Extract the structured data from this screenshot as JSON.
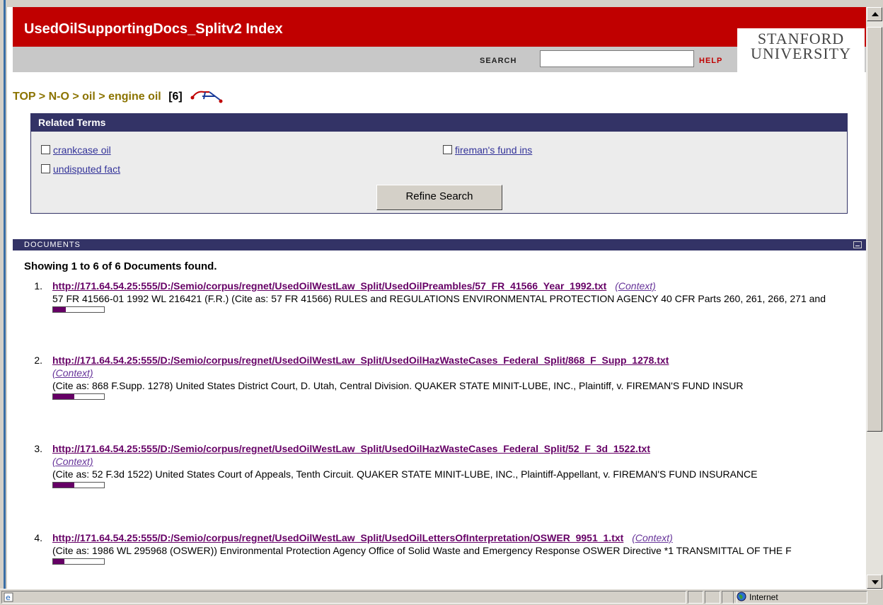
{
  "header": {
    "title": "UsedOilSupportingDocs_Splitv2 Index",
    "search_label": "SEARCH",
    "search_value": "",
    "help_label": "HELP",
    "logo_line1": "STANFORD",
    "logo_line2": "UNIVERSITY"
  },
  "breadcrumb": {
    "top": "TOP",
    "level1": "N-O",
    "level2": "oil",
    "current": "engine oil",
    "count": "[6]",
    "separator": ">"
  },
  "related": {
    "heading": "Related Terms",
    "terms": [
      "crankcase oil",
      "undisputed fact",
      "fireman's fund ins"
    ],
    "refine_label": "Refine Search"
  },
  "documents": {
    "section_label": "DOCUMENTS",
    "showing": "Showing 1 to 6 of 6 Documents found.",
    "context_label": "(Context)",
    "items": [
      {
        "num": "1.",
        "url": "http://171.64.54.25:555/D:/Semio/corpus/regnet/UsedOilWestLaw_Split/UsedOilPreambles/57_FR_41566_Year_1992.txt",
        "snippet": "57 FR 41566-01 1992 WL 216421 (F.R.) (Cite as: 57 FR 41566) RULES and REGULATIONS ENVIRONMENTAL PROTECTION AGENCY 40 CFR Parts 260, 261, 266, 271 and",
        "score": 0.25
      },
      {
        "num": "2.",
        "url": "http://171.64.54.25:555/D:/Semio/corpus/regnet/UsedOilWestLaw_Split/UsedOilHazWasteCases_Federal_Split/868_F_Supp_1278.txt",
        "snippet": "(Cite as: 868 F.Supp. 1278) United States District Court, D. Utah, Central Division. QUAKER STATE MINIT-LUBE, INC., Plaintiff, v. FIREMAN'S FUND INSUR",
        "score": 0.42
      },
      {
        "num": "3.",
        "url": "http://171.64.54.25:555/D:/Semio/corpus/regnet/UsedOilWestLaw_Split/UsedOilHazWasteCases_Federal_Split/52_F_3d_1522.txt",
        "snippet": "(Cite as: 52 F.3d 1522) United States Court of Appeals, Tenth Circuit. QUAKER STATE MINIT-LUBE, INC., Plaintiff-Appellant, v. FIREMAN'S FUND INSURANCE",
        "score": 0.42
      },
      {
        "num": "4.",
        "url": "http://171.64.54.25:555/D:/Semio/corpus/regnet/UsedOilWestLaw_Split/UsedOilLettersOfInterpretation/OSWER_9951_1.txt",
        "snippet": "(Cite as: 1986 WL 295968 (OSWER)) Environmental Protection Agency Office of Solid Waste and Emergency Response OSWER Directive *1 TRANSMITTAL OF THE F",
        "score": 0.22
      }
    ]
  },
  "statusbar": {
    "zone": "Internet",
    "icon": "ie-page-icon"
  },
  "colors": {
    "header_red": "#c00000",
    "nav_blue": "#333366",
    "link_purple": "#660066",
    "crumb_olive": "#8b7300"
  }
}
